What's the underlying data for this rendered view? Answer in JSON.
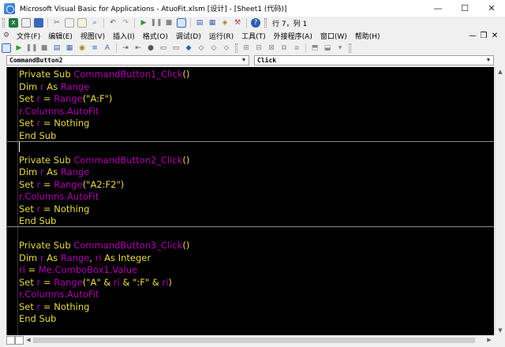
{
  "window": {
    "title": "Microsoft Visual Basic for Applications - AtuoFit.xlsm [设计] - [Sheet1 (代码)]",
    "minimize": "—",
    "maximize": "☐",
    "close": "✕"
  },
  "toolbar": {
    "position": "行 7，列 1"
  },
  "menu": {
    "items": [
      "文件(F)",
      "编辑(E)",
      "视图(V)",
      "插入(I)",
      "格式(O)",
      "调试(D)",
      "运行(R)",
      "工具(T)",
      "外接程序(A)",
      "窗口(W)",
      "帮助(H)"
    ],
    "mdi_min": "—",
    "mdi_restore": "❐",
    "mdi_close": "✕"
  },
  "object_combo": {
    "value": "CommandButton2"
  },
  "proc_combo": {
    "value": "Click"
  },
  "code": {
    "block1": {
      "l1": [
        "Private Sub ",
        "CommandButton1",
        "_Click",
        "()"
      ],
      "l2": [
        "Dim ",
        "r",
        " As ",
        "Range"
      ],
      "l3": [
        "Set ",
        "r",
        " = ",
        "Range",
        "(\"A:F\")"
      ],
      "l4": [
        "r",
        ".",
        "Columns",
        ".",
        "AutoFit"
      ],
      "l5": [
        "Set ",
        "r",
        " = Nothing"
      ],
      "l6": [
        "End Sub"
      ]
    },
    "block2": {
      "l1": [
        "Private Sub ",
        "CommandButton2",
        "_Click",
        "()"
      ],
      "l2": [
        "Dim ",
        "r",
        " As ",
        "Range"
      ],
      "l3": [
        "Set ",
        "r",
        " = ",
        "Range",
        "(\"A2:F2\")"
      ],
      "l4": [
        "r",
        ".",
        "Columns",
        ".",
        "AutoFit"
      ],
      "l5": [
        "Set ",
        "r",
        " = Nothing"
      ],
      "l6": [
        "End Sub"
      ]
    },
    "block3": {
      "l1": [
        "Private Sub ",
        "CommandButton3",
        "_Click",
        "()"
      ],
      "l2": [
        "Dim ",
        "r",
        " As ",
        "Range",
        ", ",
        "ri",
        " As Integer"
      ],
      "l3": [
        "ri",
        " = ",
        "Me",
        ".",
        "ComboBox1",
        ".",
        "Value"
      ],
      "l4": [
        "Set ",
        "r",
        " = ",
        "Range",
        "(\"A\" & ",
        "ri",
        " & \":F\" & ",
        "ri",
        ")"
      ],
      "l5": [
        "r",
        ".",
        "Columns",
        ".",
        "AutoFit"
      ],
      "l6": [
        "Set ",
        "r",
        " = Nothing"
      ],
      "l7": [
        "End Sub"
      ]
    }
  },
  "colors": {
    "keyword": "#e8d84a",
    "identifier": "#b000b0",
    "editor_bg": "#000000"
  }
}
